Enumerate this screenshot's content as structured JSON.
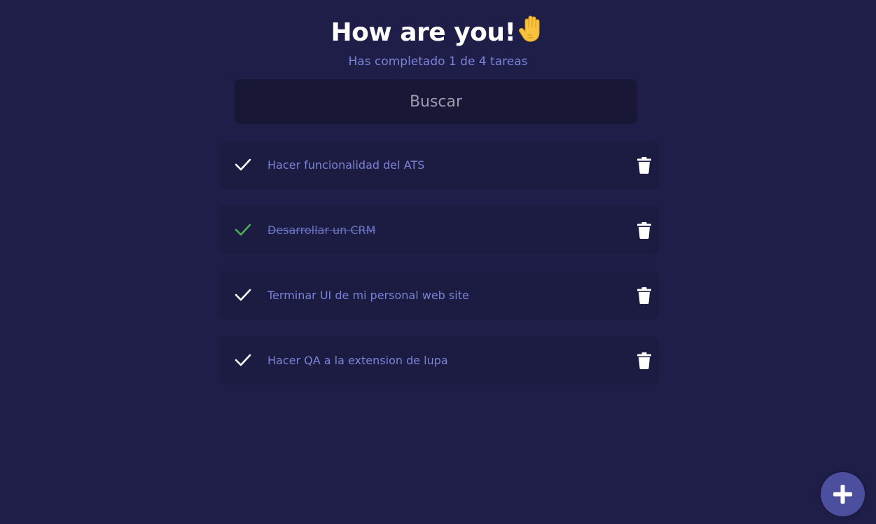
{
  "header": {
    "title": "How are you!",
    "emoji": "raised-hand-emoji",
    "subtitle": "Has completado 1 de 4 tareas"
  },
  "search": {
    "placeholder": "Buscar",
    "value": ""
  },
  "todos": [
    {
      "text": "Hacer funcionalidad del ATS",
      "completed": false
    },
    {
      "text": "Desarrollar un CRM",
      "completed": true
    },
    {
      "text": "Terminar UI de mi personal web site",
      "completed": false
    },
    {
      "text": "Hacer QA a la extension de lupa",
      "completed": false
    }
  ],
  "icons": {
    "check": "check-icon",
    "delete": "trash-icon",
    "add": "plus-icon"
  },
  "colors": {
    "background": "#1f1e48",
    "card": "#1c1b42",
    "search_bg": "#181736",
    "text_accent": "#7a83d6",
    "check_default": "#ffffff",
    "check_completed": "#4caf50",
    "fab": "#4b4f9e"
  }
}
